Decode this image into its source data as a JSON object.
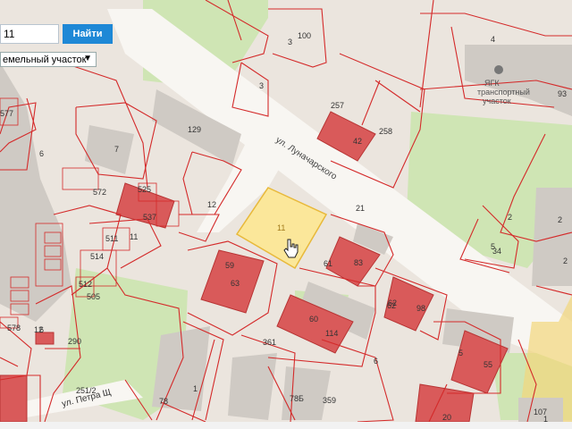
{
  "search": {
    "value": "11",
    "button_label": "Найти"
  },
  "layer_select": {
    "selected": "емельный участок"
  },
  "streets": {
    "lunacharskogo": "ул. Луначарского",
    "petra": "ул. Петра Щ"
  },
  "poi": {
    "title_line1": "ЯГК",
    "title_line2": "транспортный",
    "title_line3": "участок"
  },
  "selected_parcel": {
    "label": "11"
  },
  "parcel_labels": [
    "100",
    "3",
    "3",
    "4",
    "93",
    "257",
    "42",
    "258",
    "129",
    "7",
    "6",
    "12",
    "21",
    "11",
    "59",
    "63",
    "61",
    "83",
    "62",
    "98",
    "60",
    "114",
    "290",
    "361",
    "1",
    "78",
    "78Б",
    "359",
    "6",
    "5",
    "55",
    "20",
    "107",
    "2",
    "2",
    "34",
    "5",
    "6",
    "2",
    "12",
    "251/2",
    "525",
    "537",
    "511",
    "514",
    "505",
    "512",
    "572",
    "577",
    "578",
    "1",
    "62"
  ],
  "colors": {
    "parcel_border": "#d42a2a",
    "building": "#d95a5a",
    "selected": "#fbe79a",
    "green": "#cfe6b5",
    "road": "#f7f5f2"
  }
}
